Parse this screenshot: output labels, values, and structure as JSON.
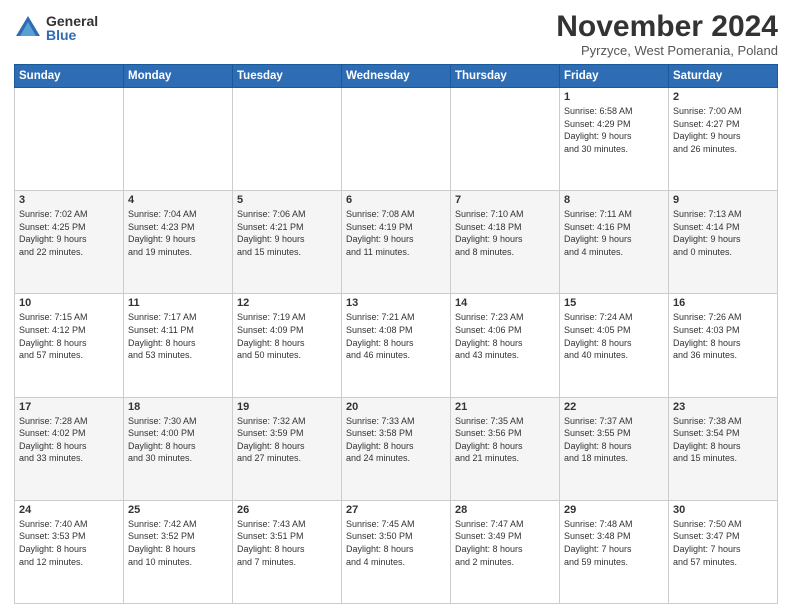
{
  "logo": {
    "general": "General",
    "blue": "Blue"
  },
  "header": {
    "title": "November 2024",
    "subtitle": "Pyrzyce, West Pomerania, Poland"
  },
  "weekdays": [
    "Sunday",
    "Monday",
    "Tuesday",
    "Wednesday",
    "Thursday",
    "Friday",
    "Saturday"
  ],
  "weeks": [
    [
      {
        "day": "",
        "info": ""
      },
      {
        "day": "",
        "info": ""
      },
      {
        "day": "",
        "info": ""
      },
      {
        "day": "",
        "info": ""
      },
      {
        "day": "",
        "info": ""
      },
      {
        "day": "1",
        "info": "Sunrise: 6:58 AM\nSunset: 4:29 PM\nDaylight: 9 hours\nand 30 minutes."
      },
      {
        "day": "2",
        "info": "Sunrise: 7:00 AM\nSunset: 4:27 PM\nDaylight: 9 hours\nand 26 minutes."
      }
    ],
    [
      {
        "day": "3",
        "info": "Sunrise: 7:02 AM\nSunset: 4:25 PM\nDaylight: 9 hours\nand 22 minutes."
      },
      {
        "day": "4",
        "info": "Sunrise: 7:04 AM\nSunset: 4:23 PM\nDaylight: 9 hours\nand 19 minutes."
      },
      {
        "day": "5",
        "info": "Sunrise: 7:06 AM\nSunset: 4:21 PM\nDaylight: 9 hours\nand 15 minutes."
      },
      {
        "day": "6",
        "info": "Sunrise: 7:08 AM\nSunset: 4:19 PM\nDaylight: 9 hours\nand 11 minutes."
      },
      {
        "day": "7",
        "info": "Sunrise: 7:10 AM\nSunset: 4:18 PM\nDaylight: 9 hours\nand 8 minutes."
      },
      {
        "day": "8",
        "info": "Sunrise: 7:11 AM\nSunset: 4:16 PM\nDaylight: 9 hours\nand 4 minutes."
      },
      {
        "day": "9",
        "info": "Sunrise: 7:13 AM\nSunset: 4:14 PM\nDaylight: 9 hours\nand 0 minutes."
      }
    ],
    [
      {
        "day": "10",
        "info": "Sunrise: 7:15 AM\nSunset: 4:12 PM\nDaylight: 8 hours\nand 57 minutes."
      },
      {
        "day": "11",
        "info": "Sunrise: 7:17 AM\nSunset: 4:11 PM\nDaylight: 8 hours\nand 53 minutes."
      },
      {
        "day": "12",
        "info": "Sunrise: 7:19 AM\nSunset: 4:09 PM\nDaylight: 8 hours\nand 50 minutes."
      },
      {
        "day": "13",
        "info": "Sunrise: 7:21 AM\nSunset: 4:08 PM\nDaylight: 8 hours\nand 46 minutes."
      },
      {
        "day": "14",
        "info": "Sunrise: 7:23 AM\nSunset: 4:06 PM\nDaylight: 8 hours\nand 43 minutes."
      },
      {
        "day": "15",
        "info": "Sunrise: 7:24 AM\nSunset: 4:05 PM\nDaylight: 8 hours\nand 40 minutes."
      },
      {
        "day": "16",
        "info": "Sunrise: 7:26 AM\nSunset: 4:03 PM\nDaylight: 8 hours\nand 36 minutes."
      }
    ],
    [
      {
        "day": "17",
        "info": "Sunrise: 7:28 AM\nSunset: 4:02 PM\nDaylight: 8 hours\nand 33 minutes."
      },
      {
        "day": "18",
        "info": "Sunrise: 7:30 AM\nSunset: 4:00 PM\nDaylight: 8 hours\nand 30 minutes."
      },
      {
        "day": "19",
        "info": "Sunrise: 7:32 AM\nSunset: 3:59 PM\nDaylight: 8 hours\nand 27 minutes."
      },
      {
        "day": "20",
        "info": "Sunrise: 7:33 AM\nSunset: 3:58 PM\nDaylight: 8 hours\nand 24 minutes."
      },
      {
        "day": "21",
        "info": "Sunrise: 7:35 AM\nSunset: 3:56 PM\nDaylight: 8 hours\nand 21 minutes."
      },
      {
        "day": "22",
        "info": "Sunrise: 7:37 AM\nSunset: 3:55 PM\nDaylight: 8 hours\nand 18 minutes."
      },
      {
        "day": "23",
        "info": "Sunrise: 7:38 AM\nSunset: 3:54 PM\nDaylight: 8 hours\nand 15 minutes."
      }
    ],
    [
      {
        "day": "24",
        "info": "Sunrise: 7:40 AM\nSunset: 3:53 PM\nDaylight: 8 hours\nand 12 minutes."
      },
      {
        "day": "25",
        "info": "Sunrise: 7:42 AM\nSunset: 3:52 PM\nDaylight: 8 hours\nand 10 minutes."
      },
      {
        "day": "26",
        "info": "Sunrise: 7:43 AM\nSunset: 3:51 PM\nDaylight: 8 hours\nand 7 minutes."
      },
      {
        "day": "27",
        "info": "Sunrise: 7:45 AM\nSunset: 3:50 PM\nDaylight: 8 hours\nand 4 minutes."
      },
      {
        "day": "28",
        "info": "Sunrise: 7:47 AM\nSunset: 3:49 PM\nDaylight: 8 hours\nand 2 minutes."
      },
      {
        "day": "29",
        "info": "Sunrise: 7:48 AM\nSunset: 3:48 PM\nDaylight: 7 hours\nand 59 minutes."
      },
      {
        "day": "30",
        "info": "Sunrise: 7:50 AM\nSunset: 3:47 PM\nDaylight: 7 hours\nand 57 minutes."
      }
    ]
  ]
}
